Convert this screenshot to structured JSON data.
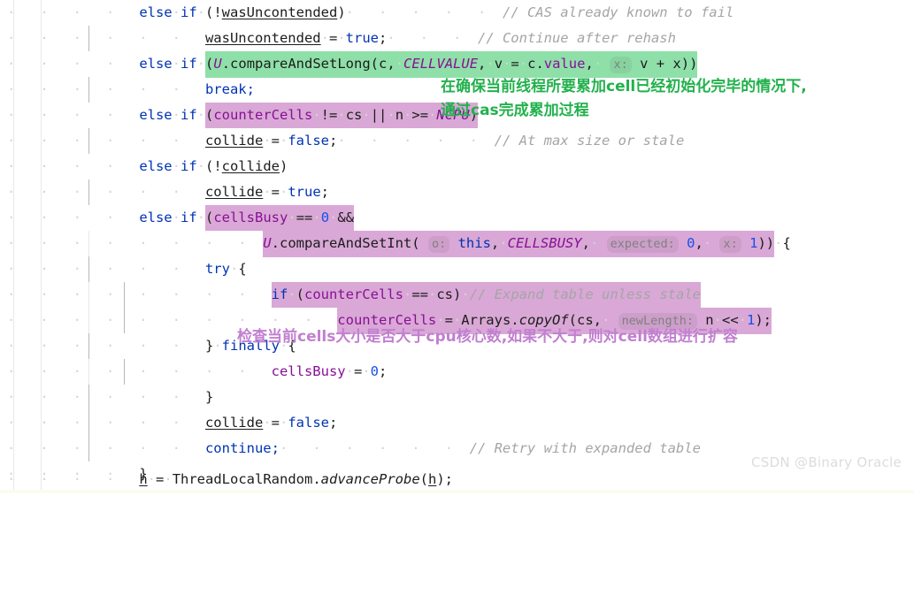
{
  "editor": {
    "language": "java",
    "theme": "light",
    "colors": {
      "keyword": "#0033b3",
      "comment": "#a5a5a5",
      "field": "#871094",
      "number": "#1750eb",
      "text": "#1c1c1c",
      "highlight_green": "#8fdfa9",
      "highlight_purple": "#d9a8d6",
      "annotation_green": "#22b14c",
      "annotation_purple": "#c17fd0",
      "whitespace_dot": "#d4d4d4"
    },
    "lines": [
      {
        "n": 1,
        "text": "    else if (!wasUncontended)       // CAS already known to fail"
      },
      {
        "n": 2,
        "text": "        wasUncontended = true;      // Continue after rehash"
      },
      {
        "n": 3,
        "text": "    else if (U.compareAndSetLong(c, CELLVALUE, v = c.value,  x: v + x))"
      },
      {
        "n": 4,
        "text": "        break;"
      },
      {
        "n": 5,
        "text": "    else if (counterCells != cs || n >= NCPU)"
      },
      {
        "n": 6,
        "text": "        collide = false;           // At max size or stale"
      },
      {
        "n": 7,
        "text": "    else if (!collide)"
      },
      {
        "n": 8,
        "text": "        collide = true;"
      },
      {
        "n": 9,
        "text": "    else if (cellsBusy == 0 &&"
      },
      {
        "n": 10,
        "text": "            U.compareAndSetInt( o: this, CELLSBUSY,  expected: 0,  x: 1)) {"
      },
      {
        "n": 11,
        "text": "        try {"
      },
      {
        "n": 12,
        "text": "            if (counterCells == cs) // Expand table unless stale"
      },
      {
        "n": 13,
        "text": "                counterCells = Arrays.copyOf(cs,  newLength: n << 1);"
      },
      {
        "n": 14,
        "text": "        } finally {"
      },
      {
        "n": 15,
        "text": "            cellsBusy = 0;"
      },
      {
        "n": 16,
        "text": "        }"
      },
      {
        "n": 17,
        "text": "        collide = false;"
      },
      {
        "n": 18,
        "text": "        continue;                  // Retry with expanded table"
      },
      {
        "n": 19,
        "text": "    }"
      },
      {
        "n": 20,
        "text": "    h = ThreadLocalRandom.advanceProbe(h);"
      }
    ],
    "parameter_hints": [
      {
        "line": 3,
        "name": "x:",
        "value": "v + x"
      },
      {
        "line": 10,
        "name": "o:",
        "value": "this"
      },
      {
        "line": 10,
        "name": "expected:",
        "value": "0"
      },
      {
        "line": 10,
        "name": "x:",
        "value": "1"
      },
      {
        "line": 13,
        "name": "newLength:",
        "value": "n << 1"
      }
    ],
    "comments": [
      {
        "line": 1,
        "text": "// CAS already known to fail"
      },
      {
        "line": 2,
        "text": "// Continue after rehash"
      },
      {
        "line": 6,
        "text": "// At max size or stale"
      },
      {
        "line": 12,
        "text": "// Expand table unless stale"
      },
      {
        "line": 18,
        "text": "// Retry with expanded table"
      }
    ],
    "highlights": [
      {
        "line": 3,
        "color": "green",
        "span": "(U.compareAndSetLong(c, CELLVALUE, v = c.value,  x: v + x))"
      },
      {
        "line": 5,
        "color": "purple",
        "span": "(counterCells != cs || n >= NCPU)"
      },
      {
        "line": 9,
        "color": "purple",
        "span": "(cellsBusy == 0 &&"
      },
      {
        "line": 10,
        "color": "purple",
        "span": "U.compareAndSetInt( o: this, CELLSBUSY,  expected: 0,  x: 1))"
      },
      {
        "line": 12,
        "color": "purple",
        "span": "if (counterCells == cs) // Expand table unless stale"
      },
      {
        "line": 13,
        "color": "purple",
        "span": "counterCells = Arrays.copyOf(cs,  newLength: n << 1);"
      }
    ]
  },
  "tokens": {
    "kw_else": "else",
    "kw_if": "if",
    "kw_true": "true",
    "kw_false": "false",
    "kw_break": "break;",
    "kw_try": "try",
    "kw_finally": "finally",
    "kw_continue": "continue;",
    "kw_this": "this",
    "var_wasUncontended": "wasUncontended",
    "var_collide": "collide",
    "var_cellsBusy": "cellsBusy",
    "var_counterCells": "counterCells",
    "var_cs": "cs",
    "var_c": "c",
    "var_v": "v",
    "var_x": "x",
    "var_n": "n",
    "var_h": "h",
    "const_CELLVALUE": "CELLVALUE",
    "const_NCPU": "NCPU",
    "const_CELLSBUSY": "CELLSBUSY",
    "cls_U": "U",
    "cls_Arrays": "Arrays",
    "cls_ThreadLocalRandom": "ThreadLocalRandom",
    "m_compareAndSetLong": "compareAndSetLong",
    "m_compareAndSetInt": "compareAndSetInt",
    "m_copyOf": "copyOf",
    "m_advanceProbe": "advanceProbe",
    "m_value": "value"
  },
  "annotations": {
    "green": {
      "line1": "在确保当前线程所要累加cell已经初始化完毕的情况下,",
      "line2": "通过cas完成累加过程"
    },
    "purple": {
      "line1": "检查当前cells大小是否大于cpu核心数,如果不大于,则对cell数组进行扩容"
    }
  },
  "watermark": {
    "text": "CSDN @Binary Oracle"
  }
}
